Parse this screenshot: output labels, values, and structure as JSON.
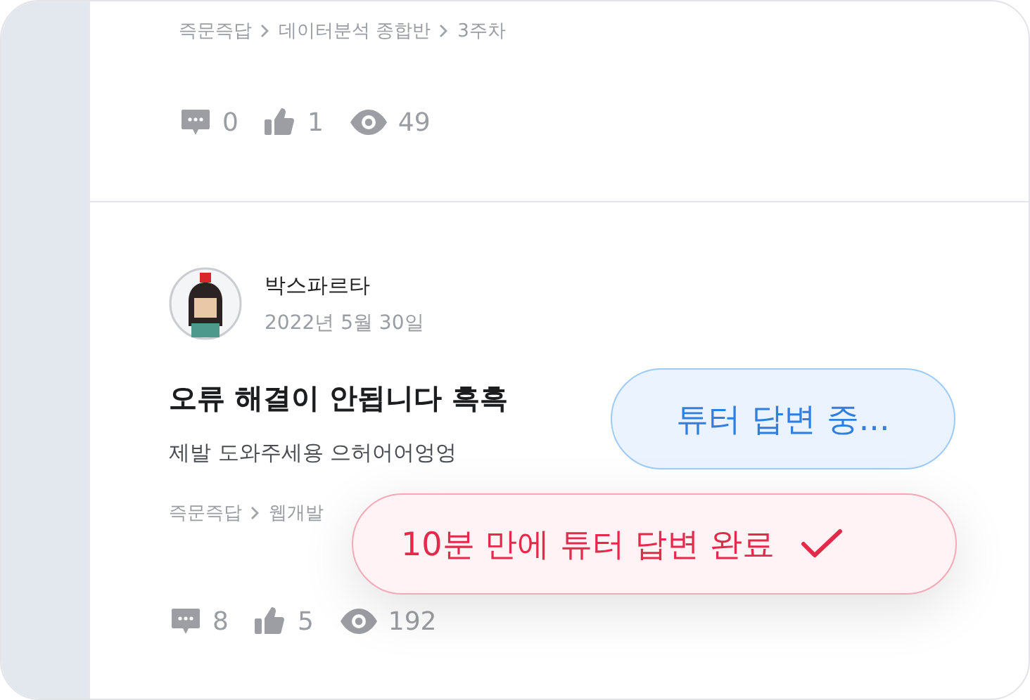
{
  "posts": [
    {
      "breadcrumb": [
        "즉문즉답",
        "데이터분석 종합반",
        "3주차"
      ],
      "stats": {
        "comments": "0",
        "likes": "1",
        "views": "49"
      }
    },
    {
      "author": "박스파르타",
      "date": "2022년 5월 30일",
      "title": "오류 해결이 안됩니다 흑흑",
      "body": "제발 도와주세용 으허어어엉엉",
      "breadcrumb": [
        "즉문즉답",
        "웹개발"
      ],
      "stats": {
        "comments": "8",
        "likes": "5",
        "views": "192"
      }
    }
  ],
  "badges": [
    {
      "kind": "pending",
      "label": "튜터 답변 중..."
    },
    {
      "kind": "done",
      "label": "10분 만에 튜터 답변 완료"
    }
  ]
}
